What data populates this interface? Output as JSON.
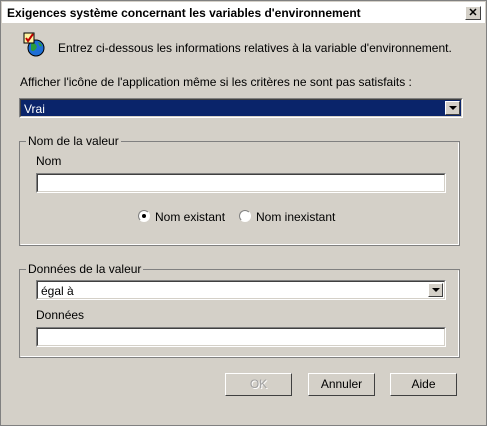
{
  "window": {
    "title": "Exigences système concernant les variables d'environnement",
    "close_symbol": "✕"
  },
  "intro": {
    "icon": "globe-check-icon",
    "text": "Entrez ci-dessous les informations relatives à la variable d'environnement."
  },
  "show_icon": {
    "label": "Afficher l'icône de l'application même si les critères ne sont pas satisfaits :",
    "value": "Vrai"
  },
  "value_name_group": {
    "title": "Nom de la valeur",
    "name_label": "Nom",
    "name_value": "",
    "radio_existing": "Nom existant",
    "radio_nonexisting": "Nom inexistant",
    "selected": "existing"
  },
  "value_data_group": {
    "title": "Données de la valeur",
    "operator_value": "égal à",
    "data_label": "Données",
    "data_value": ""
  },
  "buttons": {
    "ok": "OK",
    "cancel": "Annuler",
    "help": "Aide"
  },
  "colors": {
    "selection": "#0a246a",
    "face": "#d4d0c8"
  }
}
